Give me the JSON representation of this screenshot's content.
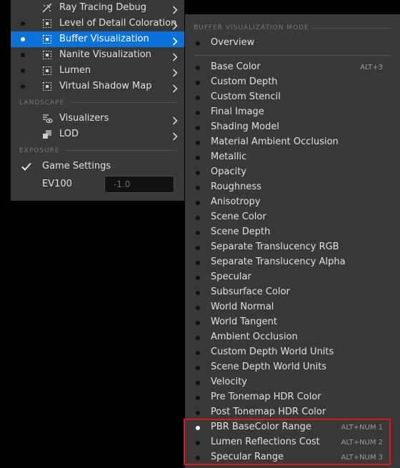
{
  "left_menu": {
    "items": [
      {
        "label": "Ray Tracing Debug",
        "icon": "ray-tracing-icon",
        "selected": false,
        "has_dot": false
      },
      {
        "label": "Level of Detail Coloration",
        "icon": "grid-icon",
        "selected": false,
        "has_dot": true
      },
      {
        "label": "Buffer Visualization",
        "icon": "grid-icon",
        "selected": true,
        "has_dot": true
      },
      {
        "label": "Nanite Visualization",
        "icon": "grid-icon",
        "selected": false,
        "has_dot": true
      },
      {
        "label": "Lumen",
        "icon": "grid-icon",
        "selected": false,
        "has_dot": true
      },
      {
        "label": "Virtual Shadow Map",
        "icon": "grid-icon",
        "selected": false,
        "has_dot": true
      }
    ],
    "landscape_header": "LANDSCAPE",
    "landscape_items": [
      {
        "label": "Visualizers",
        "icon": "visualizers-icon"
      },
      {
        "label": "LOD",
        "icon": "lod-icon"
      }
    ],
    "exposure_header": "EXPOSURE",
    "game_settings_label": "Game Settings",
    "game_settings_checked": true,
    "ev100_label": "EV100",
    "ev100_value": "-1.0"
  },
  "submenu": {
    "header": "BUFFER VISUALIZATION MODE",
    "overview_label": "Overview",
    "items": [
      {
        "label": "Base Color",
        "shortcut": "ALT+3"
      },
      {
        "label": "Custom Depth",
        "shortcut": ""
      },
      {
        "label": "Custom Stencil",
        "shortcut": ""
      },
      {
        "label": "Final Image",
        "shortcut": ""
      },
      {
        "label": "Shading Model",
        "shortcut": ""
      },
      {
        "label": "Material Ambient Occlusion",
        "shortcut": ""
      },
      {
        "label": "Metallic",
        "shortcut": ""
      },
      {
        "label": "Opacity",
        "shortcut": ""
      },
      {
        "label": "Roughness",
        "shortcut": ""
      },
      {
        "label": "Anisotropy",
        "shortcut": ""
      },
      {
        "label": "Scene Color",
        "shortcut": ""
      },
      {
        "label": "Scene Depth",
        "shortcut": ""
      },
      {
        "label": "Separate Translucency RGB",
        "shortcut": ""
      },
      {
        "label": "Separate Translucency Alpha",
        "shortcut": ""
      },
      {
        "label": "Specular",
        "shortcut": ""
      },
      {
        "label": "Subsurface Color",
        "shortcut": ""
      },
      {
        "label": "World Normal",
        "shortcut": ""
      },
      {
        "label": "World Tangent",
        "shortcut": ""
      },
      {
        "label": "Ambient Occlusion",
        "shortcut": ""
      },
      {
        "label": "Custom Depth World Units",
        "shortcut": ""
      },
      {
        "label": "Scene Depth World Units",
        "shortcut": ""
      },
      {
        "label": "Velocity",
        "shortcut": ""
      },
      {
        "label": "Pre Tonemap HDR Color",
        "shortcut": ""
      },
      {
        "label": "Post Tonemap HDR Color",
        "shortcut": ""
      },
      {
        "label": "PBR BaseColor Range",
        "shortcut": "ALT+NUM 1",
        "active": true
      },
      {
        "label": "Lumen Reflections Cost",
        "shortcut": "ALT+NUM 2"
      },
      {
        "label": "Specular Range",
        "shortcut": "ALT+NUM 3"
      }
    ]
  },
  "colors": {
    "menu_bg": "#383838",
    "selection": "#0b72d9",
    "highlight_border": "#e0171e"
  }
}
